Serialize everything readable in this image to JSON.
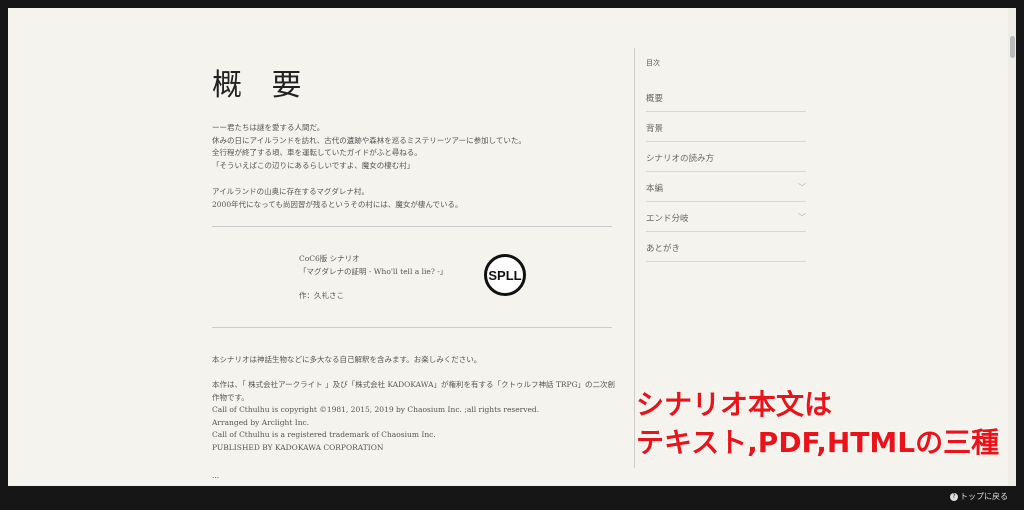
{
  "main": {
    "title": "概 要",
    "intro": [
      "ーー君たちは謎を愛する人間だ。",
      "休みの日にアイルランドを訪れ、古代の遺跡や森林を巡るミステリーツアーに参加していた。",
      "全行程が終了する頃、車を運転していたガイドがふと尋ねる。",
      "「そういえばこの辺りにあるらしいですよ、魔女の棲む村」"
    ],
    "village": [
      "アイルランドの山奥に存在するマグダレナ村。",
      "2000年代になっても尚因習が残るというその村には、魔女が棲んでいる。"
    ],
    "scenario": {
      "system": "CoC6版 シナリオ",
      "name": "「マグダレナの証明 - Who'll tell a lie? -」",
      "author": "作：久礼さこ",
      "seal": "SPLL"
    },
    "notice": "本シナリオは神話生物などに多大なる自己解釈を含みます。お楽しみください。",
    "credits": [
      "本作は、「 株式会社アークライト 」及び「株式会社 KADOKAWA」が権利を有する「クトゥルフ神話 TRPG」の二次創",
      "作物です。",
      "Call of Cthulhu is copyright ©1981, 2015, 2019 by Chaosium Inc. ;all rights reserved.",
      "Arranged by Arclight Inc.",
      "Call of Cthulhu is a registered trademark of Chaosium Inc.",
      "PUBLISHED BY KADOKAWA CORPORATION"
    ],
    "ellipsis": "..."
  },
  "toc": {
    "title": "目次",
    "items": [
      {
        "label": "概要"
      },
      {
        "label": "背景"
      },
      {
        "label": "シナリオの読み方"
      },
      {
        "label": "本編",
        "chevron": "﹀"
      },
      {
        "label": "エンド分岐",
        "chevron": "﹀"
      },
      {
        "label": "あとがき"
      }
    ]
  },
  "overlay": [
    "シナリオ本文は",
    "テキスト,PDF,HTMLの三種"
  ],
  "footer": {
    "icon": "?",
    "back_to_top": "トップに戻る"
  }
}
